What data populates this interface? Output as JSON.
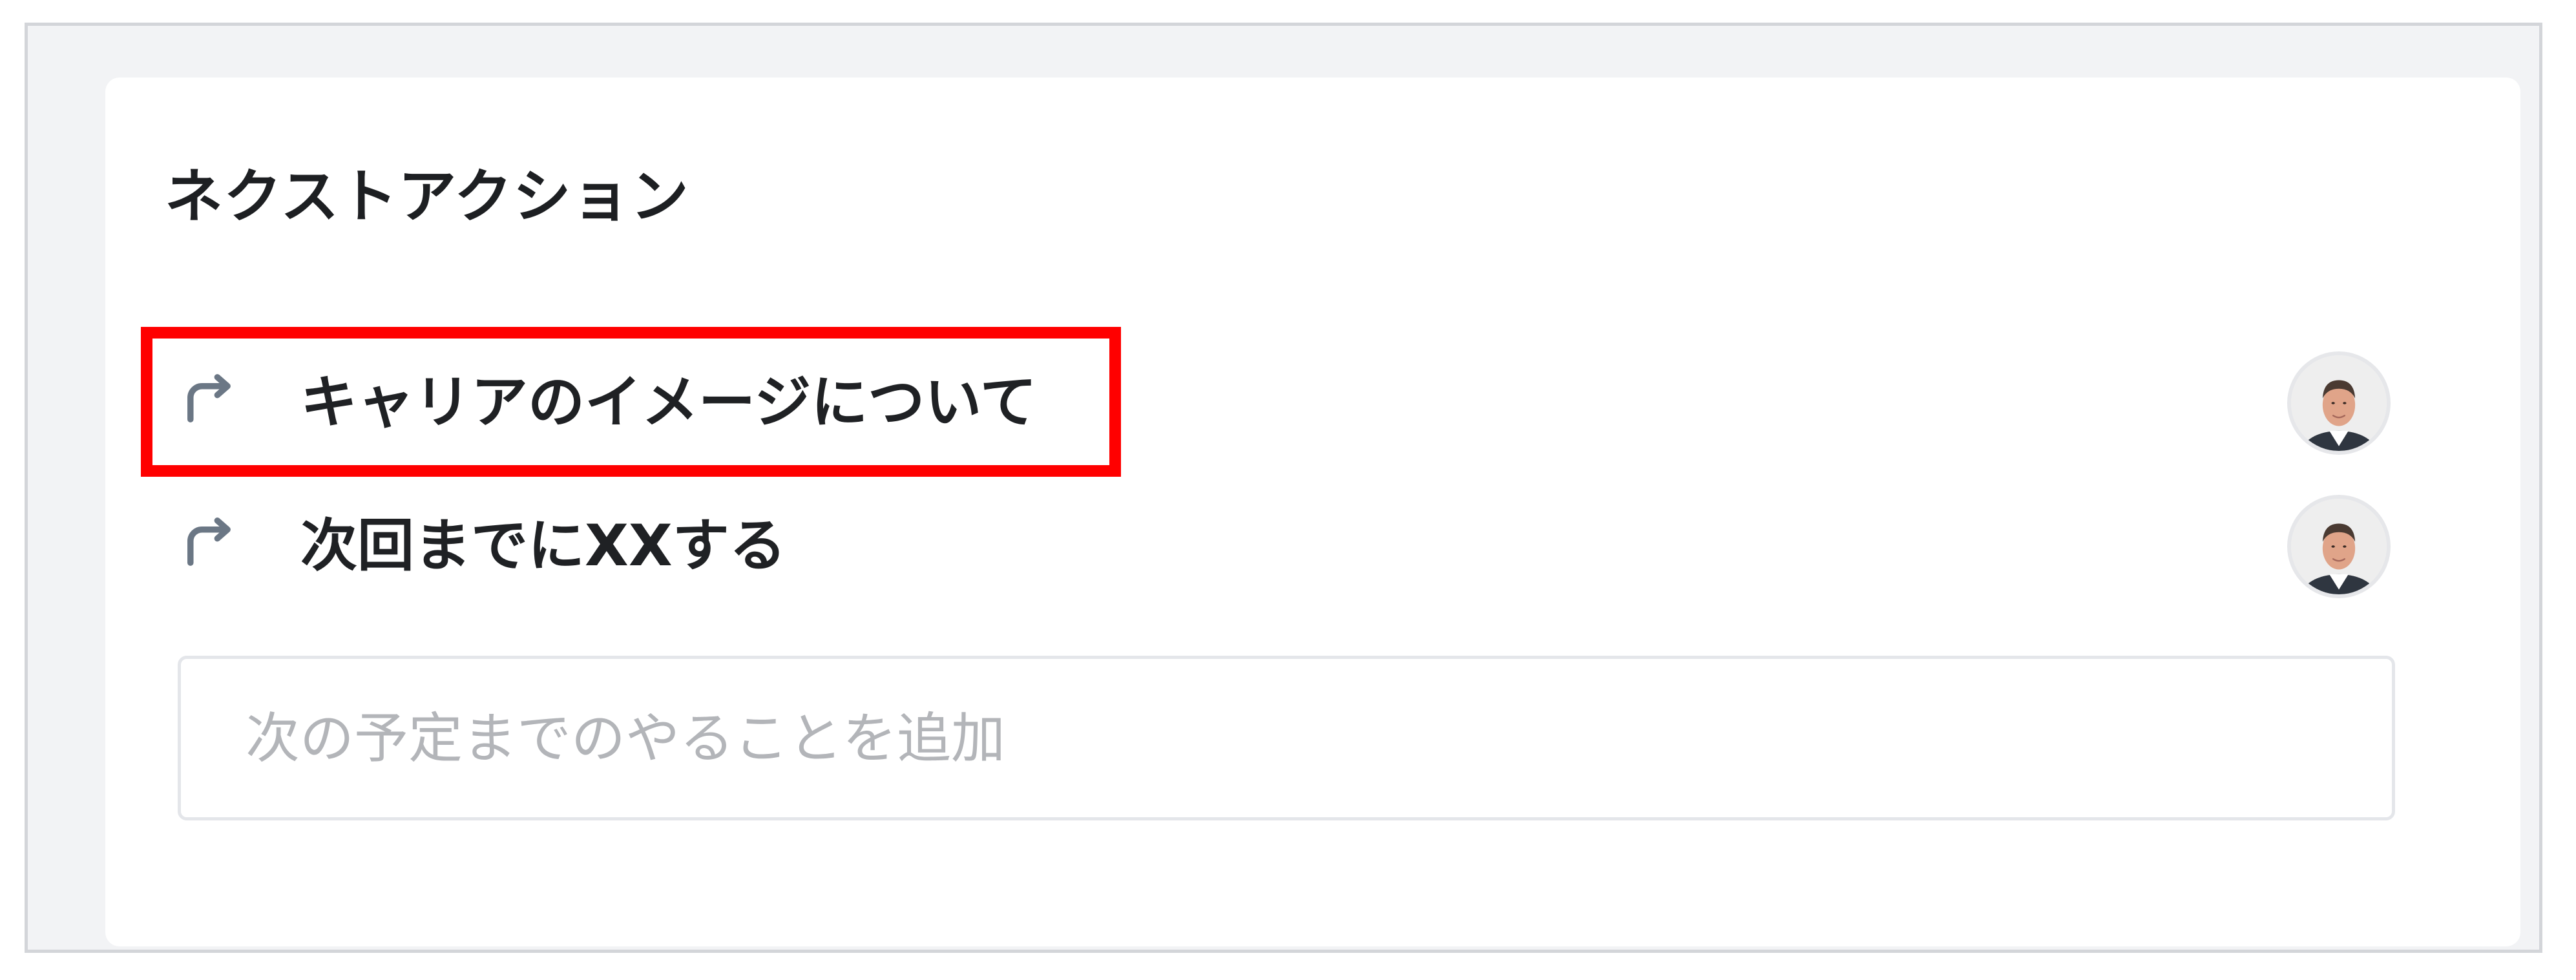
{
  "next_actions": {
    "title": "ネクストアクション",
    "items": [
      {
        "label": "キャリアのイメージについて",
        "icon": "repeat-icon",
        "assignee_icon": "avatar",
        "highlighted": true
      },
      {
        "label": "次回までにXXする",
        "icon": "repeat-icon",
        "assignee_icon": "avatar",
        "highlighted": false
      }
    ],
    "add_input": {
      "placeholder": "次の予定までのやることを追加",
      "value": ""
    }
  },
  "colors": {
    "highlight": "#ff0000",
    "frame_background": "#f2f3f5",
    "icon": "#6b7785",
    "placeholder": "#b3b5b9"
  }
}
